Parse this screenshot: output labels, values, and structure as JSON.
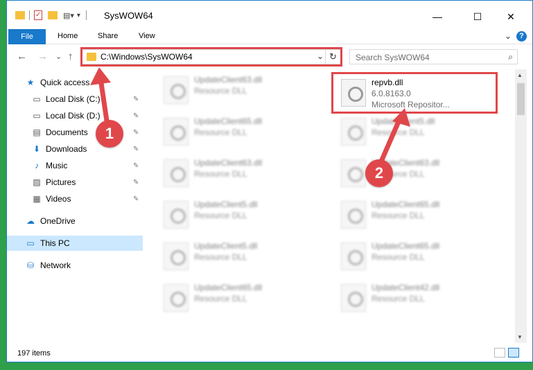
{
  "window": {
    "title": "SysWOW64",
    "minimize_glyph": "—",
    "maximize_glyph": "☐",
    "close_glyph": "✕"
  },
  "ribbon": {
    "tabs": [
      "File",
      "Home",
      "Share",
      "View"
    ],
    "help_glyph": "?",
    "collapse_glyph": "⌄"
  },
  "address_bar": {
    "path": "C:\\Windows\\SysWOW64",
    "dropdown_glyph": "⌄",
    "refresh_glyph": "↻"
  },
  "search": {
    "placeholder": "Search SysWOW64",
    "icon_glyph": "⌕"
  },
  "nav_buttons": {
    "back": "←",
    "forward": "→",
    "recent": "⌄",
    "up": "↑"
  },
  "nav_pane": {
    "items": [
      {
        "label": "Quick access",
        "icon": "star-icon",
        "glyph": "★",
        "pinned": false
      },
      {
        "label": "Local Disk (C:)",
        "icon": "drive-icon",
        "glyph": "▭",
        "pinned": true
      },
      {
        "label": "Local Disk (D:)",
        "icon": "drive-icon",
        "glyph": "▭",
        "pinned": true
      },
      {
        "label": "Documents",
        "icon": "documents-icon",
        "glyph": "▤",
        "pinned": true
      },
      {
        "label": "Downloads",
        "icon": "download-icon",
        "glyph": "⬇",
        "pinned": true
      },
      {
        "label": "Music",
        "icon": "music-icon",
        "glyph": "♪",
        "pinned": true
      },
      {
        "label": "Pictures",
        "icon": "pictures-icon",
        "glyph": "▨",
        "pinned": true
      },
      {
        "label": "Videos",
        "icon": "videos-icon",
        "glyph": "▦",
        "pinned": true
      },
      {
        "label": "OneDrive",
        "icon": "cloud-icon",
        "glyph": "☁",
        "pinned": false
      },
      {
        "label": "This PC",
        "icon": "computer-icon",
        "glyph": "▭",
        "pinned": false,
        "selected": true
      },
      {
        "label": "Network",
        "icon": "network-icon",
        "glyph": "⛁",
        "pinned": false
      }
    ],
    "pin_glyph": "📌"
  },
  "files": {
    "left_column": [
      {
        "name": "UpdateClient63.dll",
        "type": "Resource DLL"
      },
      {
        "name": "UpdateClient65.dll",
        "type": "Resource DLL"
      },
      {
        "name": "UpdateClient63.dll",
        "type": "Resource DLL"
      },
      {
        "name": "UpdateClient5.dll",
        "type": "Resource DLL"
      },
      {
        "name": "UpdateClient5.dll",
        "type": "Resource DLL"
      },
      {
        "name": "UpdateClient65.dll",
        "type": "Resource DLL"
      }
    ],
    "highlighted": {
      "name": "repvb.dll",
      "version": "6.0.8163.0",
      "company": "Microsoft Repositor..."
    },
    "right_column": [
      {
        "name": "UpdateClient5.dll",
        "type": "Resource DLL"
      },
      {
        "name": "UpdateClient63.dll",
        "type": "Resource DLL"
      },
      {
        "name": "UpdateClient65.dll",
        "type": "Resource DLL"
      },
      {
        "name": "UpdateClient65.dll",
        "type": "Resource DLL"
      },
      {
        "name": "UpdateClient42.dll",
        "type": "Resource DLL"
      }
    ]
  },
  "status": {
    "item_count": "197 items"
  },
  "annotations": {
    "step1": "1",
    "step2": "2",
    "color": "#e0474b"
  },
  "colors": {
    "accent": "#1979ca",
    "selection": "#cce8ff",
    "annotation_red": "#e0474b",
    "desktop": "#2e9f4b"
  }
}
